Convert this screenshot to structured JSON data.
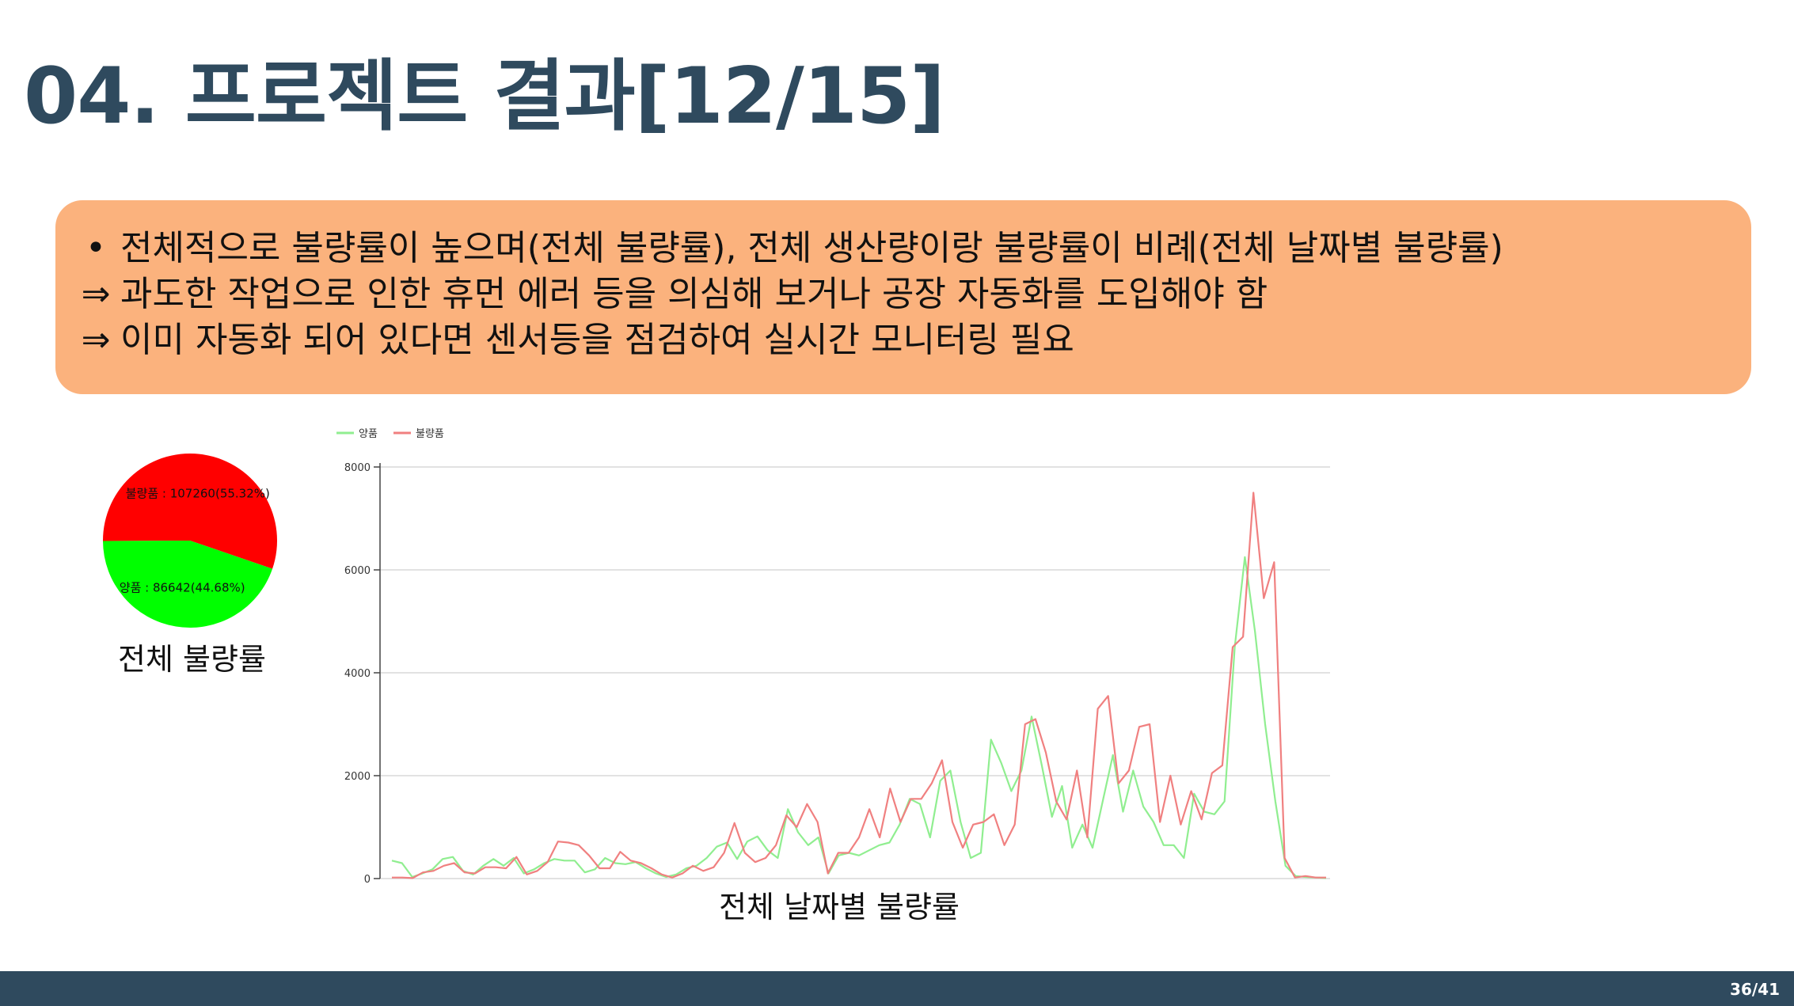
{
  "slide": {
    "title": "04. 프로젝트 결과[12/15]",
    "page_number": "36/41"
  },
  "callout": {
    "bullet": "•",
    "arrow": "⇒",
    "line1": "전체적으로 불량률이 높으며(전체 불량률), 전체 생산량이랑 불량률이 비례(전체 날짜별 불량률)",
    "line2": "과도한 작업으로 인한 휴먼 에러 등을 의심해 보거나 공장 자동화를 도입해야 함",
    "line3": "이미 자동화 되어 있다면 센서등을 점검하여 실시간 모니터링 필요"
  },
  "colors": {
    "title": "#2f4a5e",
    "callout_bg": "#fbb27d",
    "footer_bg": "#2f4a5e",
    "good": "#00ff00",
    "defect": "#ff0000",
    "good_line": "#90ee90",
    "defect_line": "#f08080"
  },
  "chart_data": [
    {
      "type": "pie",
      "caption": "전체 불량률",
      "slices": [
        {
          "label": "불량품 : 107260(55.32%)",
          "value": 107260,
          "color": "#ff0000"
        },
        {
          "label": "양품 : 86642(44.68%)",
          "value": 86642,
          "color": "#00ff00"
        }
      ]
    },
    {
      "type": "line",
      "caption": "전체 날짜별 불량률",
      "ylim": [
        0,
        8000
      ],
      "yticks": [
        0,
        2000,
        4000,
        6000,
        8000
      ],
      "legend_position": "top-left",
      "grid": true,
      "series": [
        {
          "name": "양품",
          "color": "#90ee90",
          "values": [
            350,
            300,
            30,
            100,
            180,
            380,
            420,
            150,
            80,
            250,
            380,
            250,
            400,
            100,
            180,
            300,
            380,
            350,
            350,
            120,
            180,
            400,
            300,
            280,
            320,
            200,
            100,
            30,
            80,
            200,
            250,
            400,
            620,
            700,
            380,
            720,
            820,
            550,
            400,
            1350,
            900,
            650,
            800,
            100,
            450,
            500,
            450,
            550,
            650,
            700,
            1050,
            1550,
            1450,
            800,
            1900,
            2100,
            1100,
            400,
            500,
            2700,
            2250,
            1700,
            2100,
            3150,
            2200,
            1200,
            1800,
            600,
            1050,
            600,
            1500,
            2400,
            1300,
            2100,
            1400,
            1100,
            650,
            650,
            400,
            1650,
            1300,
            1250,
            1500,
            4500,
            6250,
            4800,
            3000,
            1500,
            250,
            50,
            30,
            20,
            10
          ],
          "values_line": []
        },
        {
          "name": "불량품",
          "color": "#f08080",
          "values": [
            20,
            20,
            10,
            120,
            150,
            250,
            300,
            120,
            100,
            220,
            220,
            200,
            420,
            80,
            150,
            320,
            720,
            700,
            650,
            450,
            200,
            200,
            520,
            350,
            300,
            200,
            80,
            20,
            100,
            250,
            150,
            220,
            500,
            1080,
            500,
            320,
            400,
            650,
            1230,
            1000,
            1450,
            1100,
            100,
            500,
            500,
            800,
            1350,
            800,
            1750,
            1100,
            1550,
            1550,
            1850,
            2300,
            1100,
            600,
            1050,
            1100,
            1250,
            650,
            1050,
            3000,
            3100,
            2450,
            1500,
            1150,
            2100,
            800,
            3300,
            3550,
            1850,
            2100,
            2950,
            3000,
            1100,
            2000,
            1050,
            1700,
            1150,
            2050,
            2200,
            4500,
            4700,
            7500,
            5450,
            6150,
            400,
            20,
            50,
            20,
            20
          ]
        }
      ]
    }
  ]
}
